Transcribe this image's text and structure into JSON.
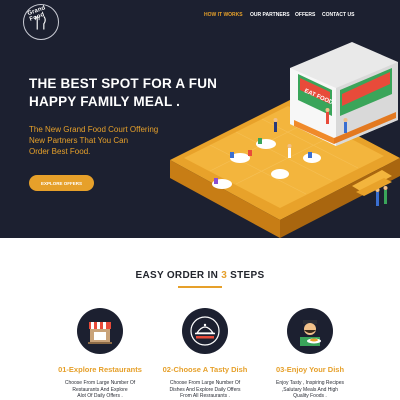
{
  "brand": {
    "logo_text": "Grand Food"
  },
  "nav": {
    "how_it_works": "HOW IT WORKS",
    "our_partners": "OUR PARTNERS",
    "offers": "OFFERS",
    "contact_us": "CONTACT US"
  },
  "hero": {
    "title_line1": "THE BEST SPOT FOR A FUN",
    "title_line2": "HAPPY FAMILY MEAL .",
    "subtitle_line1": "The New Grand Food Court Offering",
    "subtitle_line2": "New Partners That You Can",
    "subtitle_line3": "Order Best Food.",
    "cta_label": "EXPLORE OFFERS",
    "sign_text": "EAT FOOD"
  },
  "steps": {
    "title_prefix": "EASY ORDER IN ",
    "title_number": "3",
    "title_suffix": " STEPS",
    "items": [
      {
        "title": "01-Explore Restaurants",
        "desc_line1": "Choose From Large Number Of",
        "desc_line2": "Restaurants And Explore",
        "desc_line3": "Alot Of Daily Offers ."
      },
      {
        "title": "02-Choose A Tasty Dish",
        "desc_line1": "Choose From Large Number Of",
        "desc_line2": "Dishes And Explore Daily Offers",
        "desc_line3": "From All Resraurants ."
      },
      {
        "title": "03-Enjoy Your Dish",
        "desc_line1": "Enjoy Tasty , Inspiring Recipes",
        "desc_line2": ",Salutary Meals  And High",
        "desc_line3": "Quality Foods ."
      }
    ]
  },
  "colors": {
    "dark": "#1c2030",
    "accent": "#e6a02a",
    "white": "#ffffff"
  }
}
